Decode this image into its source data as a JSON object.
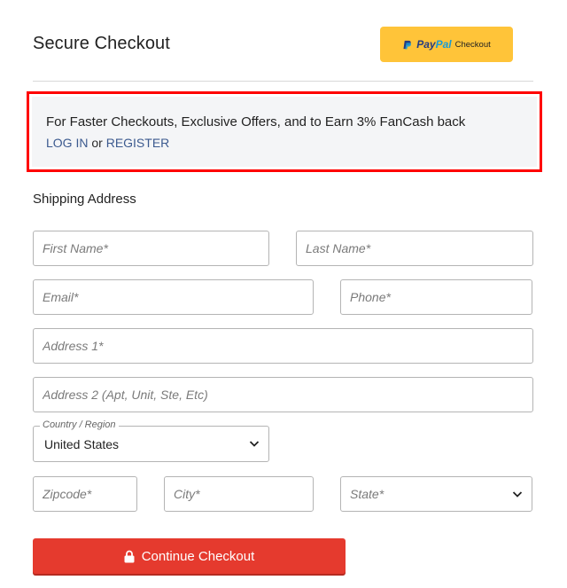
{
  "header": {
    "title": "Secure Checkout",
    "paypal_button": {
      "brand_pay": "Pay",
      "brand_pal": "Pal",
      "label": "Checkout",
      "icon": "paypal-logo-icon"
    }
  },
  "promo": {
    "message": "For Faster Checkouts, Exclusive Offers, and to Earn 3% FanCash back",
    "login_label": "LOG IN",
    "or_text": "or",
    "register_label": "REGISTER"
  },
  "shipping": {
    "section_title": "Shipping Address",
    "fields": {
      "first_name": {
        "placeholder": "First Name*",
        "value": ""
      },
      "last_name": {
        "placeholder": "Last Name*",
        "value": ""
      },
      "email": {
        "placeholder": "Email*",
        "value": ""
      },
      "phone": {
        "placeholder": "Phone*",
        "value": ""
      },
      "address1": {
        "placeholder": "Address 1*",
        "value": ""
      },
      "address2": {
        "placeholder": "Address 2 (Apt, Unit, Ste, Etc)",
        "value": ""
      },
      "country": {
        "label": "Country / Region",
        "selected": "United States",
        "icon": "chevron-down-icon"
      },
      "zipcode": {
        "placeholder": "Zipcode*",
        "value": ""
      },
      "city": {
        "placeholder": "City*",
        "value": ""
      },
      "state": {
        "placeholder": "State*",
        "icon": "chevron-down-icon"
      }
    }
  },
  "actions": {
    "continue_label": "Continue Checkout",
    "continue_icon": "lock-icon"
  },
  "colors": {
    "paypal_yellow": "#ffc439",
    "primary_red": "#e53a2e",
    "highlight_red": "#ff0000",
    "link_blue": "#3c5a8f",
    "promo_bg": "#f4f5f7"
  }
}
